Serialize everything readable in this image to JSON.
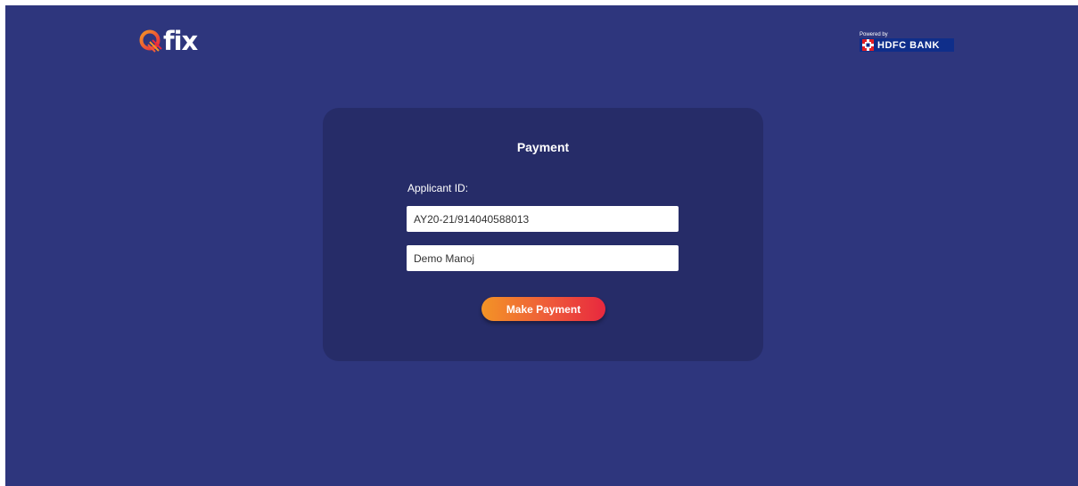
{
  "brand": {
    "logo_text": "fix",
    "logo_colors": [
      "#f39426",
      "#e8283e"
    ]
  },
  "powered_by": {
    "label": "Powered by",
    "bank_name": "HDFC BANK",
    "bank_color": "#0f2e8a",
    "bank_icon": "hdfc-logo-icon"
  },
  "payment": {
    "title": "Payment",
    "applicant_label": "Applicant ID:",
    "applicant_id_value": "AY20-21/914040588013",
    "name_value": "Demo Manoj",
    "button_label": "Make Payment"
  },
  "colors": {
    "page_background": "#2e367d",
    "card_background": "#262c68",
    "button_gradient_start": "#f39426",
    "button_gradient_end": "#e8283e"
  }
}
